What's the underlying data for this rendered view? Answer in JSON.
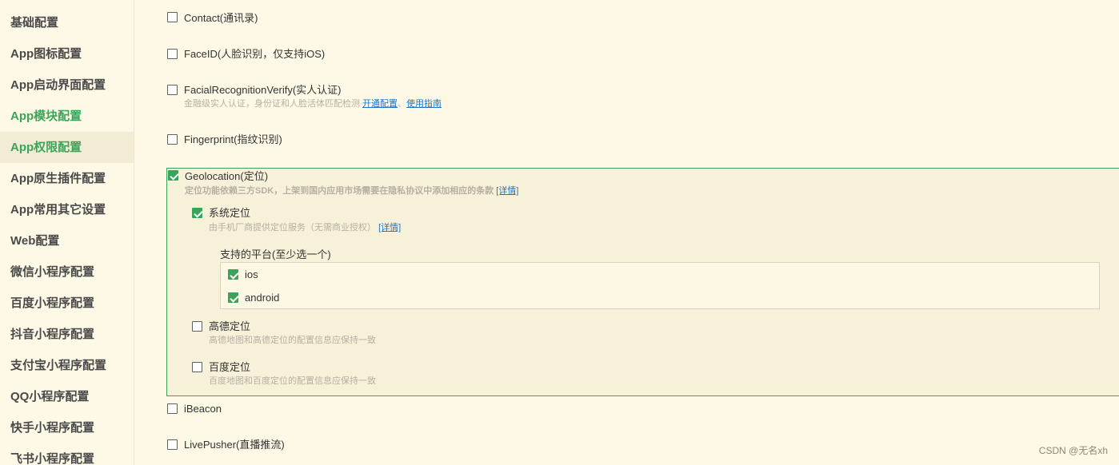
{
  "sidebar": {
    "items": [
      {
        "label": "基础配置"
      },
      {
        "label": "App图标配置"
      },
      {
        "label": "App启动界面配置"
      },
      {
        "label": "App模块配置"
      },
      {
        "label": "App权限配置"
      },
      {
        "label": "App原生插件配置"
      },
      {
        "label": "App常用其它设置"
      },
      {
        "label": "Web配置"
      },
      {
        "label": "微信小程序配置"
      },
      {
        "label": "百度小程序配置"
      },
      {
        "label": "抖音小程序配置"
      },
      {
        "label": "支付宝小程序配置"
      },
      {
        "label": "QQ小程序配置"
      },
      {
        "label": "快手小程序配置"
      },
      {
        "label": "飞书小程序配置"
      }
    ]
  },
  "modules": {
    "contact": {
      "label": "Contact(通讯录)",
      "checked": false
    },
    "faceid": {
      "label": "FaceID(人脸识别，仅支持iOS)",
      "checked": false
    },
    "facial": {
      "label": "FacialRecognitionVerify(实人认证)",
      "checked": false,
      "desc": "金融级实人认证，身份证和人脸活体匹配检测",
      "link1": "开通配置",
      "sep": "、",
      "link2": "使用指南"
    },
    "fingerprint": {
      "label": "Fingerprint(指纹识别)",
      "checked": false
    },
    "geolocation": {
      "label": "Geolocation(定位)",
      "checked": true,
      "desc": "定位功能依赖三方SDK，上架到国内应用市场需要在隐私协议中添加相应的条款",
      "link": "[详情]",
      "system": {
        "label": "系统定位",
        "checked": true,
        "desc": "由手机厂商提供定位服务（无需商业授权）",
        "link": "[详情]",
        "platform_title": "支持的平台(至少选一个)",
        "platforms": [
          {
            "label": "ios",
            "checked": true
          },
          {
            "label": "android",
            "checked": true
          }
        ]
      },
      "amap": {
        "label": "高德定位",
        "checked": false,
        "desc": "高德地图和高德定位的配置信息应保持一致"
      },
      "baidu": {
        "label": "百度定位",
        "checked": false,
        "desc": "百度地图和百度定位的配置信息应保持一致"
      }
    },
    "ibeacon": {
      "label": "iBeacon",
      "checked": false
    },
    "livepusher": {
      "label": "LivePusher(直播推流)",
      "checked": false
    }
  },
  "watermark": "CSDN @无名xh",
  "colors": {
    "accent": "#3aa55a",
    "link": "#1e73c8",
    "background": "#fef9e6"
  }
}
